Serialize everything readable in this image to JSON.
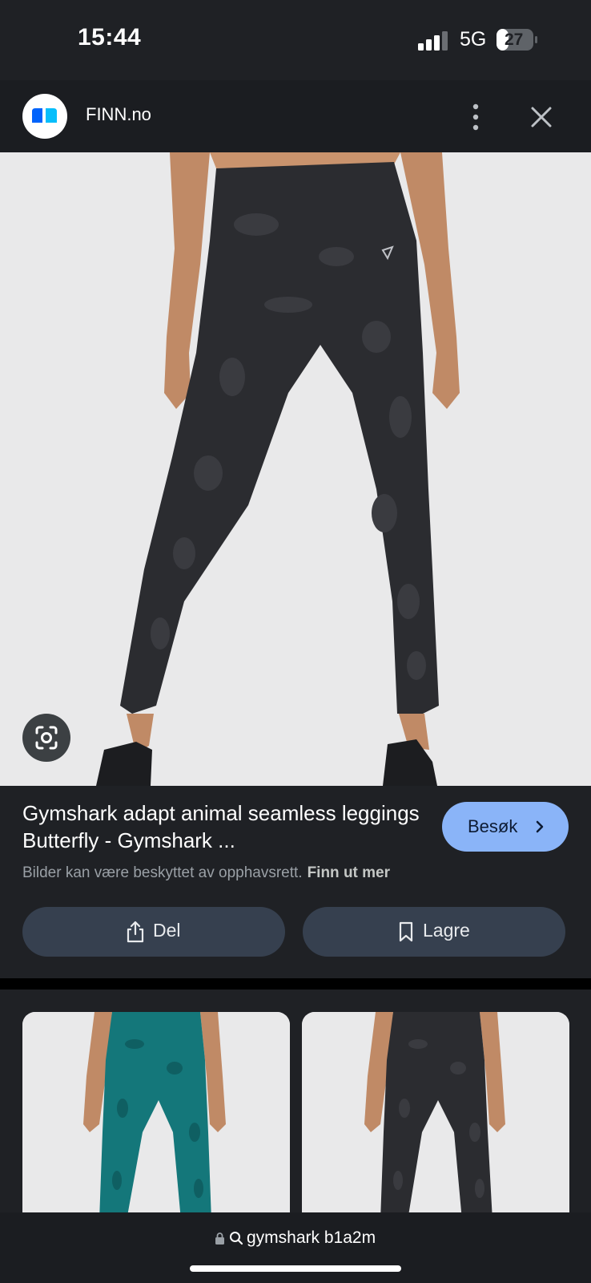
{
  "status_bar": {
    "time": "15:44",
    "network": "5G",
    "battery": "27"
  },
  "header": {
    "site_name": "FINN.no",
    "more_icon": "more-vert-icon",
    "close_icon": "close-icon"
  },
  "result": {
    "title": "Gymshark adapt animal seamless leggings Butterfly - Gymshark ...",
    "visit_label": "Besøk",
    "copyright_note": "Bilder kan være beskyttet av opphavsrett.",
    "learn_more": "Finn ut mer",
    "share_label": "Del",
    "save_label": "Lagre"
  },
  "search": {
    "query": "gymshark b1a2m"
  },
  "colors": {
    "background": "#1f2125",
    "accent": "#8ab4f8",
    "pill": "#36404f",
    "image_bg": "#e9e9ea",
    "leggings_dark": "#2b2c30",
    "leggings_teal": "#14777a"
  }
}
